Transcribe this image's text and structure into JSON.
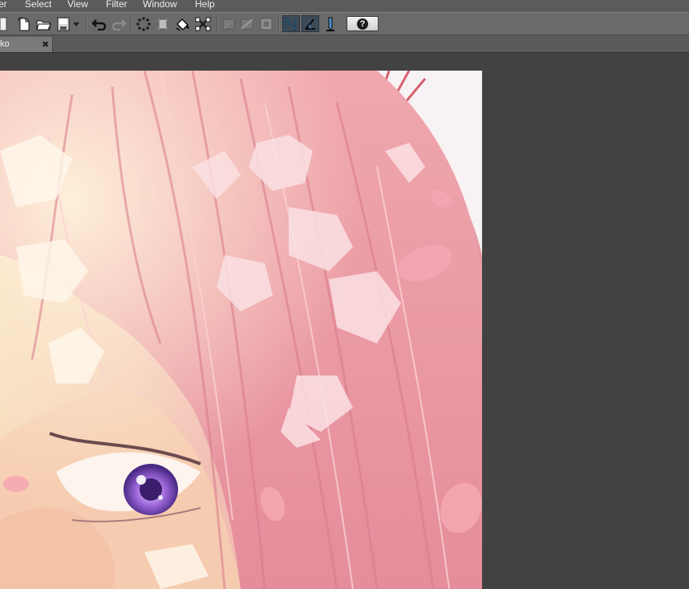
{
  "menu": {
    "items": [
      "er",
      "Select",
      "View",
      "Filter",
      "Window",
      "Help"
    ]
  },
  "toolbar": {
    "tools": [
      "new-document-icon",
      "open-folder-icon",
      "save-icon",
      "dropdown-arrow-icon",
      "undo-icon",
      "redo-icon",
      "selection-dots-icon",
      "crop-icon",
      "fill-icon",
      "transform-icon",
      "ruler-disabled-icon",
      "grid-disabled-icon",
      "frame-disabled-icon",
      "pen-stabilizer-icon",
      "angle-icon",
      "pen-pressure-icon",
      "help-icon"
    ],
    "help_symbol": "?"
  },
  "tab": {
    "label": "ko",
    "close_glyph": "✖"
  },
  "colors": {
    "workspace": "#424242",
    "menubar": "#5b5b5b",
    "toolbar": "#6a6a6a",
    "pressed_button": "#3d4a57",
    "hair_pink": "#e9a1a8"
  }
}
